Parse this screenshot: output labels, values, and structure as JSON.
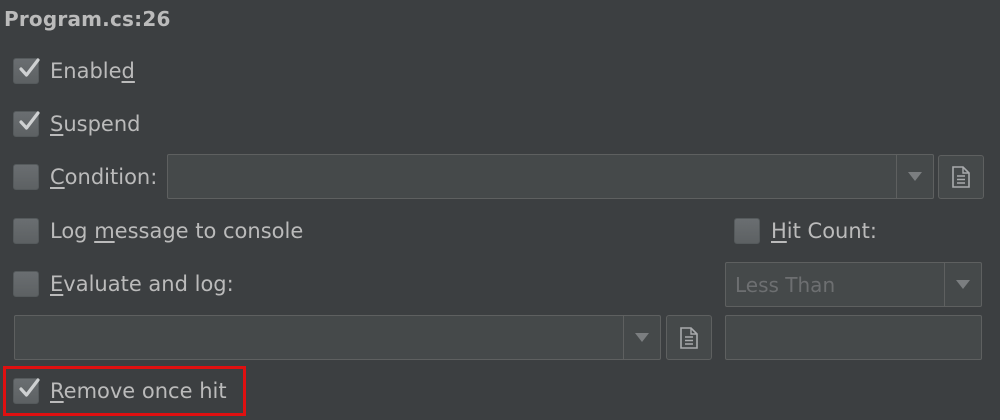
{
  "title": "Program.cs:26",
  "options": {
    "enabled": {
      "pre": "Enable",
      "mnemonic": "d",
      "post": "",
      "checked": true
    },
    "suspend": {
      "pre": "",
      "mnemonic": "S",
      "post": "uspend",
      "checked": true
    },
    "condition": {
      "pre": "",
      "mnemonic": "C",
      "post": "ondition:",
      "checked": false,
      "value": ""
    },
    "log_message": {
      "pre": "Log ",
      "mnemonic": "m",
      "post": "essage to console",
      "checked": false
    },
    "hit_count": {
      "pre": "",
      "mnemonic": "H",
      "post": "it Count:",
      "checked": false
    },
    "evaluate_log": {
      "pre": "",
      "mnemonic": "E",
      "post": "valuate and log:",
      "checked": false,
      "value": ""
    },
    "hit_count_mode": {
      "selected": "Less Than",
      "value": ""
    },
    "remove_once_hit": {
      "pre": "",
      "mnemonic": "R",
      "post": "emove once hit",
      "checked": true
    }
  },
  "icons": {
    "check": "check-icon",
    "dropdown": "chevron-down-icon",
    "document": "document-icon"
  },
  "colors": {
    "background": "#3c3f41",
    "text": "#bbbbbb",
    "field": "#45494a",
    "highlight": "#e01010"
  }
}
